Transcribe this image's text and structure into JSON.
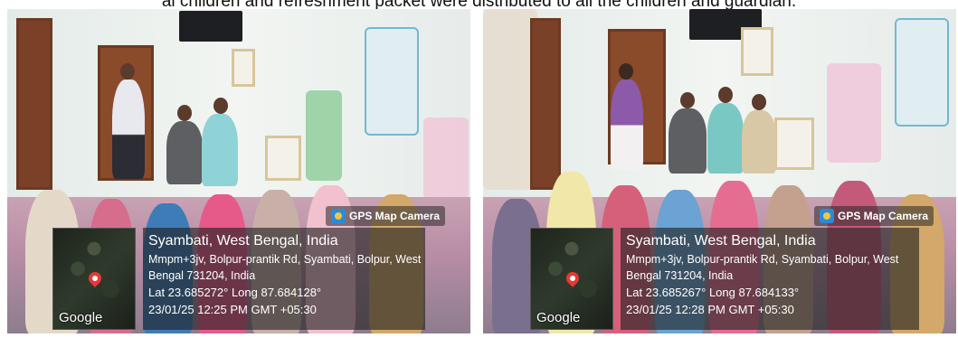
{
  "caption": "al children and refreshment packet were distributed to all the children and guardian.",
  "photos": [
    {
      "gps_tag": "GPS Map Camera",
      "location_title": "Syambati, West Bengal, India",
      "address_line1": "Mmpm+3jv, Bolpur-prantik Rd, Syambati, Bolpur, West",
      "address_line2": "Bengal 731204, India",
      "coordinates": "Lat 23.685272° Long 87.684128°",
      "datetime": "23/01/25 12:25 PM GMT +05:30",
      "map_logo": "Google"
    },
    {
      "gps_tag": "GPS Map Camera",
      "location_title": "Syambati, West Bengal, India",
      "address_line1": "Mmpm+3jv, Bolpur-prantik Rd, Syambati, Bolpur, West",
      "address_line2": "Bengal 731204, India",
      "coordinates": "Lat 23.685267° Long 87.684133°",
      "datetime": "23/01/25 12:28 PM GMT +05:30",
      "map_logo": "Google"
    }
  ],
  "colors": {
    "overlay_bg": "#1e1e1e",
    "pin": "#e53935",
    "camera_icon": "#2b8bd8"
  },
  "icons": [
    "gps-camera-icon",
    "map-pin-icon"
  ]
}
